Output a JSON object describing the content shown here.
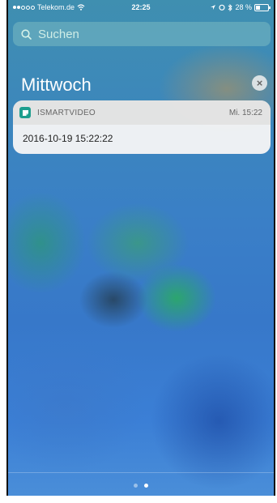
{
  "status_bar": {
    "carrier": "Telekom.de",
    "time": "22:25",
    "battery": "28 %"
  },
  "search": {
    "placeholder": "Suchen"
  },
  "day_header": {
    "title": "Mittwoch"
  },
  "notification": {
    "app_name": "ISMARTVIDEO",
    "time": "Mi. 15:22",
    "body": "2016-10-19 15:22:22",
    "icon": "app-icon"
  },
  "pager": {
    "pages": 2,
    "active_index": 1
  },
  "colors": {
    "notification_background": "#f5f5f5",
    "app_icon": "#1e9e8e"
  }
}
